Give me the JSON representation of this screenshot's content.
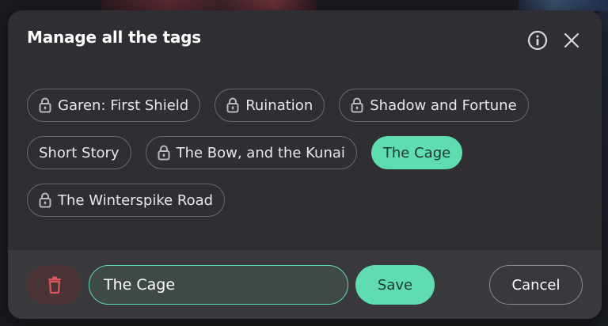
{
  "dialog": {
    "title": "Manage all the tags",
    "info_icon": "info-icon",
    "close_icon": "close-icon"
  },
  "tags": [
    {
      "label": "Garen: First Shield",
      "locked": true,
      "selected": false
    },
    {
      "label": "Ruination",
      "locked": true,
      "selected": false
    },
    {
      "label": "Shadow and Fortune",
      "locked": true,
      "selected": false
    },
    {
      "label": "Short Story",
      "locked": false,
      "selected": false
    },
    {
      "label": "The Bow, and the Kunai",
      "locked": true,
      "selected": false
    },
    {
      "label": "The Cage",
      "locked": false,
      "selected": true
    },
    {
      "label": "The Winterspike Road",
      "locked": true,
      "selected": false
    }
  ],
  "editor": {
    "delete_icon": "trash-icon",
    "input_value": "The Cage",
    "save_label": "Save",
    "cancel_label": "Cancel"
  },
  "colors": {
    "accent": "#5fdcb0",
    "dialog_bg": "#2e2e33",
    "footer_bg": "#38383d",
    "delete_bg": "#4a3335",
    "delete_icon": "#e0555f"
  }
}
